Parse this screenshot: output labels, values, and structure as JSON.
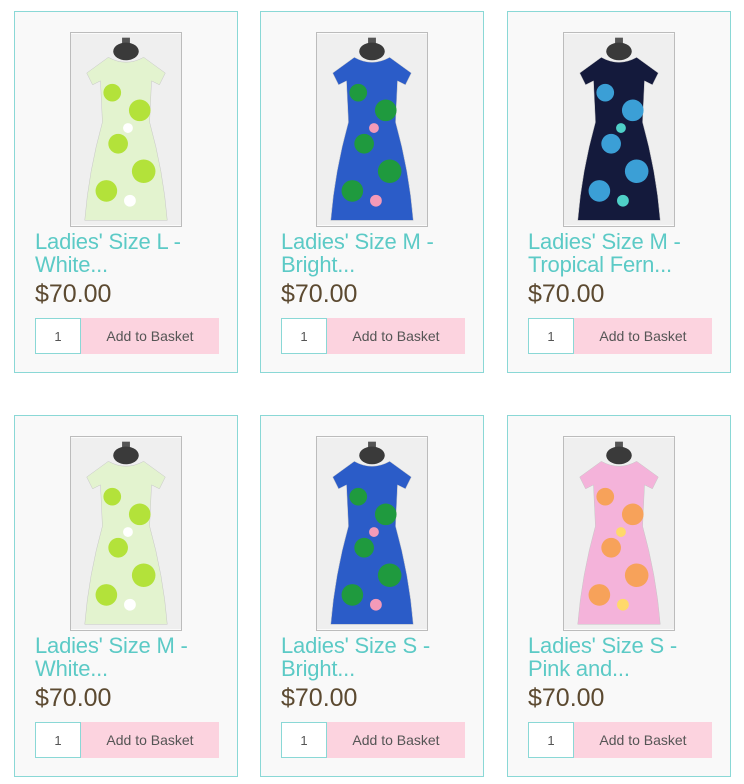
{
  "products": [
    {
      "title_line1": "Ladies' Size L -",
      "title_line2": "White...",
      "price": "$70.00",
      "qty": "1",
      "button": "Add to Basket",
      "image": "dress-white-lime-floral",
      "colors": {
        "base": "#e3f3cf",
        "print": "#b3e23a",
        "accent": "#ffffff"
      }
    },
    {
      "title_line1": "Ladies' Size M -",
      "title_line2": "Bright...",
      "price": "$70.00",
      "qty": "1",
      "button": "Add to Basket",
      "image": "dress-bright-blue-green-floral",
      "colors": {
        "base": "#2b5cc8",
        "print": "#1f9a3e",
        "accent": "#f49ab8"
      }
    },
    {
      "title_line1": "Ladies' Size M -",
      "title_line2": "Tropical Fern...",
      "price": "$70.00",
      "qty": "1",
      "button": "Add to Basket",
      "image": "dress-tropical-fern",
      "colors": {
        "base": "#141a3c",
        "print": "#3b9fd6",
        "accent": "#4fd0c8"
      }
    },
    {
      "title_line1": "Ladies' Size M -",
      "title_line2": "White...",
      "price": "$70.00",
      "qty": "1",
      "button": "Add to Basket",
      "image": "dress-white-lime-floral",
      "colors": {
        "base": "#e3f3cf",
        "print": "#b3e23a",
        "accent": "#ffffff"
      }
    },
    {
      "title_line1": "Ladies' Size S -",
      "title_line2": "Bright...",
      "price": "$70.00",
      "qty": "1",
      "button": "Add to Basket",
      "image": "dress-bright-blue-green-floral",
      "colors": {
        "base": "#2b5cc8",
        "print": "#1f9a3e",
        "accent": "#f49ab8"
      }
    },
    {
      "title_line1": "Ladies' Size S -",
      "title_line2": "Pink and...",
      "price": "$70.00",
      "qty": "1",
      "button": "Add to Basket",
      "image": "dress-pink-orange-floral",
      "colors": {
        "base": "#f4b3da",
        "print": "#f7a25a",
        "accent": "#ffd96a"
      }
    }
  ]
}
